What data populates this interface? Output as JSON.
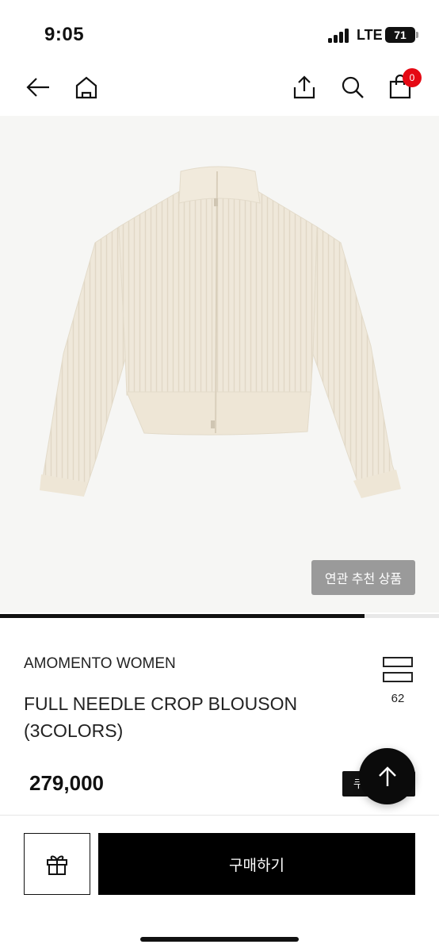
{
  "status_bar": {
    "time": "9:05",
    "network": "LTE",
    "battery": "71"
  },
  "nav": {
    "back_icon": "arrow-left-icon",
    "home_icon": "home-icon",
    "share_icon": "share-icon",
    "search_icon": "search-icon",
    "cart_icon": "shopping-bag-icon",
    "cart_count": "0",
    "badge_color": "#e50914"
  },
  "product": {
    "image_subject": "cream ribbed knit zip-up cropped blouson",
    "related_button_label": "연관 추천 상품",
    "image_progress_percent": 83,
    "brand": "AMOMENTO WOMEN",
    "title": "FULL NEEDLE CROP BLOUSON (3COLORS)",
    "layout_toggle_icon": "two-rows-icon",
    "layout_count": "62",
    "price": "279,000",
    "tag_label": "쿠폰받기"
  },
  "scroll_top": {
    "icon": "arrow-up-icon"
  },
  "bottom_bar": {
    "gift_icon": "gift-icon",
    "buy_label": "구매하기"
  }
}
